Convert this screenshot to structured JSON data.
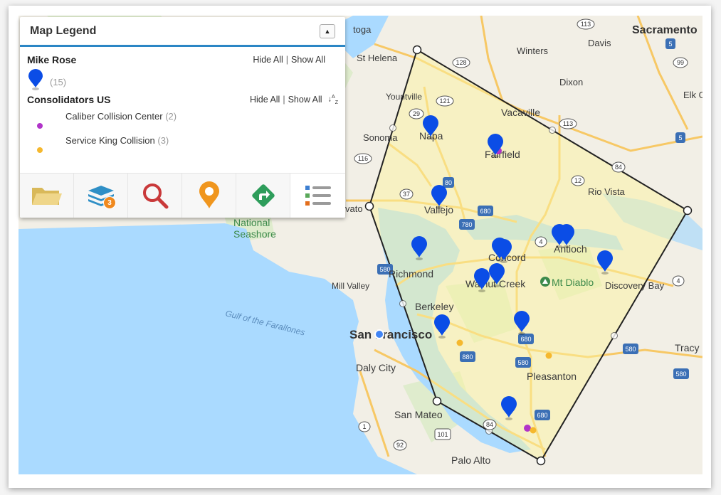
{
  "legend": {
    "title": "Map Legend",
    "collapse_icon": "caret-up-icon",
    "layers": [
      {
        "name": "Mike Rose",
        "hide_all": "Hide All",
        "separator": "|",
        "show_all": "Show All",
        "marker_count": "(15)",
        "marker_color": "#0b4de6"
      },
      {
        "name": "Consolidators US",
        "hide_all": "Hide All",
        "separator": "|",
        "show_all": "Show All",
        "sort_icon": "sort-az-icon",
        "items": [
          {
            "label": "Caliber Collision Center",
            "count": "(2)",
            "color": "#b134c9"
          },
          {
            "label": "Service King Collision",
            "count": "(3)",
            "color": "#f5b82e"
          }
        ]
      }
    ],
    "toolbar": {
      "buttons": [
        {
          "icon": "folder-icon",
          "color": "#e6c86a"
        },
        {
          "icon": "layers-icon",
          "color": "#2f8fc6",
          "badge": "3"
        },
        {
          "icon": "search-icon",
          "color": "#c9393a"
        },
        {
          "icon": "map-pin-icon",
          "color": "#f0961e"
        },
        {
          "icon": "directions-icon",
          "color": "#2e9d5b"
        },
        {
          "icon": "legend-list-icon",
          "active": true
        }
      ]
    }
  },
  "map": {
    "labels": {
      "sacramento": "Sacramento",
      "davis": "Davis",
      "winters": "Winters",
      "st_helena": "St Helena",
      "dixon": "Dixon",
      "elk_grove": "Elk G",
      "yountville": "Yountville",
      "vacaville": "Vacaville",
      "napa": "Napa",
      "sonoma": "Sonoma",
      "fairfield": "Fairfield",
      "rio_vista": "Rio Vista",
      "vallejo": "Vallejo",
      "novato": "vato",
      "national_seashore_1": "National",
      "national_seashore_2": "Seashore",
      "antioch": "Antioch",
      "concord": "Concord",
      "richmond": "Richmond",
      "mill_valley": "Mill Valley",
      "walnut_creek": "Walnut Creek",
      "mt_diablo": "Mt Diablo",
      "discovery_bay": "Discovery Bay",
      "berkeley": "Berkeley",
      "gulf_farallones": "Gulf of the Farallones",
      "san_francisco": "San Francisco",
      "tracy": "Tracy",
      "daly_city": "Daly City",
      "pleasanton": "Pleasanton",
      "san_mateo": "San Mateo",
      "palo_alto": "Palo Alto",
      "toga": "toga"
    },
    "route_shields": [
      "113",
      "128",
      "5",
      "99",
      "121",
      "29",
      "113",
      "80",
      "116",
      "12",
      "37",
      "680",
      "780",
      "4",
      "580",
      "4",
      "680",
      "880",
      "580",
      "580",
      "680",
      "84",
      "1",
      "101",
      "92",
      "84"
    ],
    "polygon_color": "#222222",
    "polygon_fill": "#fbf3a0",
    "water_color": "#aadaff",
    "land_color": "#f2efe6"
  }
}
